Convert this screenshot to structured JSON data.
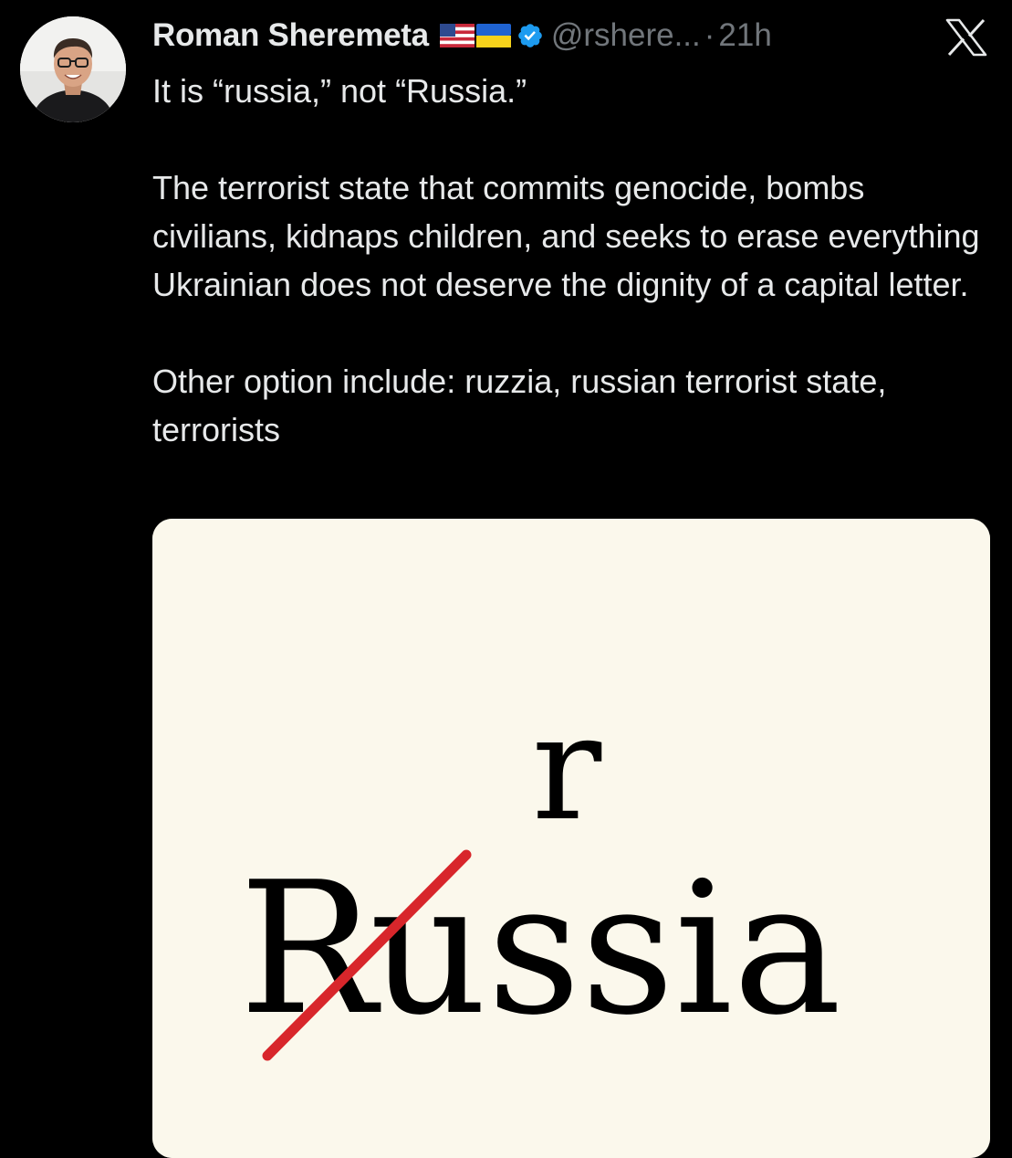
{
  "tweet": {
    "author": {
      "display_name": "Roman Sheremeta",
      "flags": [
        "us-flag-icon",
        "ukraine-flag-icon"
      ],
      "verified": true,
      "handle": "@rshere...",
      "separator": "·",
      "time": "21h"
    },
    "platform_icon": "x-logo-icon",
    "text": [
      "It is “russia,” not “Russia.”",
      "The terrorist state that commits genocide, bombs civilians, kidnaps children, and seeks to erase everything Ukrainian does not deserve the dignity of a capital letter.",
      "Other option include: ruzzia, russian terrorist state, terrorists"
    ],
    "media": {
      "replacement_letter": "r",
      "word": "Russia",
      "struck_letter": "R",
      "rest_of_word": "ussia",
      "strike_color": "#d8262b",
      "background_color": "#fbf8ec"
    }
  },
  "colors": {
    "background": "#000000",
    "primary_text": "#e7e9ea",
    "secondary_text": "#71767b",
    "verified_badge": "#1d9bf0"
  }
}
